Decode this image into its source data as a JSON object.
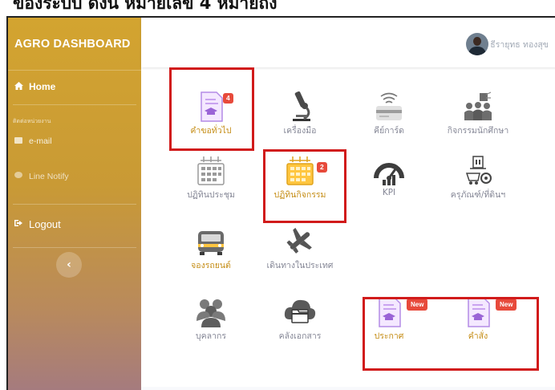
{
  "caption": "ของระบบ ดังนี้ หมายเลข 4 หมายถึง",
  "sidebar": {
    "brand": "AGRO DASHBOARD",
    "home": "Home",
    "section_heading": "ติดต่อหน่วยงาน",
    "email": "e-mail",
    "line_notify": "Line Notify",
    "logout": "Logout",
    "collapse_icon": "‹"
  },
  "header": {
    "user_name": "ธีรายุทธ ทองสุข"
  },
  "tiles": {
    "general_request": {
      "label": "คำขอทั่วไป",
      "badge": "4"
    },
    "equipment": {
      "label": "เครื่องมือ"
    },
    "key_card": {
      "label": "คีย์การ์ด"
    },
    "student_activity": {
      "label": "กิจกรรมนักศึกษา"
    },
    "meeting_calendar": {
      "label": "ปฏิทินประชุม"
    },
    "activity_calendar": {
      "label": "ปฏิทินกิจกรรม",
      "badge": "2"
    },
    "kpi": {
      "label": "KPI"
    },
    "assets": {
      "label": "ครุภัณฑ์/ที่ดินฯ"
    },
    "vehicle_booking": {
      "label": "จองรถยนต์"
    },
    "domestic_travel": {
      "label": "เดินทางในประเทศ"
    },
    "personnel": {
      "label": "บุคลากร"
    },
    "document_store": {
      "label": "คลังเอกสาร"
    },
    "announcement": {
      "label": "ประกาศ",
      "badge": "New"
    },
    "order": {
      "label": "คำสั่ง",
      "badge": "New"
    }
  },
  "colors": {
    "accent_gold": "#c58d16",
    "badge_red": "#e74a3b",
    "highlight_red": "#d11b1b",
    "icon_purple": "#a06bd8"
  }
}
